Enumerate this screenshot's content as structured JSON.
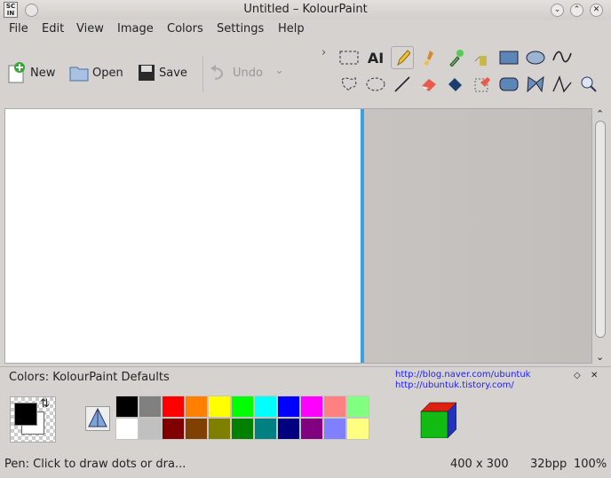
{
  "window": {
    "title": "Untitled – KolourPaint",
    "app_icon_text": "SC IN"
  },
  "menubar": {
    "items": [
      "File",
      "Edit",
      "View",
      "Image",
      "Colors",
      "Settings",
      "Help"
    ]
  },
  "toolbar": {
    "new_label": "New",
    "open_label": "Open",
    "save_label": "Save",
    "undo_label": "Undo",
    "overflow": "›"
  },
  "tools": [
    "rect-select-icon",
    "text-icon",
    "pen-icon",
    "brush-icon",
    "color-picker-icon",
    "spraycan-icon",
    "rectangle-icon",
    "ellipse-icon",
    "curve-icon",
    "free-select-icon",
    "ellipse-select-icon",
    "line-icon",
    "eraser-icon",
    "flood-fill-icon",
    "color-eraser-icon",
    "rounded-rect-icon",
    "polygon-icon",
    "polyline-icon",
    "zoom-icon"
  ],
  "colors_panel": {
    "title": "Colors: KolourPaint Defaults",
    "link1": "http://blog.naver.com/ubuntuk",
    "link2": "http://ubuntuk.tistory.com/"
  },
  "palette": {
    "top": [
      "#000000",
      "#808080",
      "#ff0000",
      "#ff8000",
      "#ffff00",
      "#00ff00",
      "#00ffff",
      "#0000ff",
      "#ff00ff",
      "#ff8080",
      "#80ff80"
    ],
    "bottom": [
      "#ffffff",
      "#c0c0c0",
      "#800000",
      "#804000",
      "#808000",
      "#008000",
      "#008080",
      "#000080",
      "#800080",
      "#8080ff",
      "#ffff80"
    ]
  },
  "statusbar": {
    "message": "Pen: Click to draw dots or dra...",
    "size": "400 x 300",
    "depth": "32bpp",
    "zoom": "100%"
  }
}
